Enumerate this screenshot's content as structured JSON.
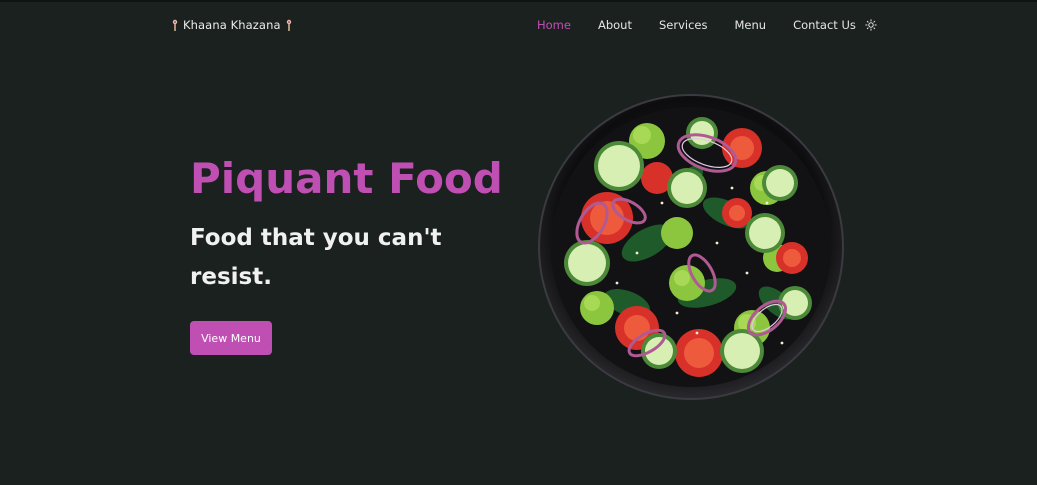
{
  "brand": {
    "name": "Khaana Khazana"
  },
  "nav": {
    "home": "Home",
    "about": "About",
    "services": "Services",
    "menu": "Menu",
    "contact": "Contact Us"
  },
  "hero": {
    "title": "Piquant Food",
    "subtitle": "Food that you can't resist.",
    "cta": "View Menu"
  },
  "colors": {
    "background": "#1b211f",
    "accent": "#c04fb3",
    "text": "#f1f1f1"
  },
  "icons": {
    "brand_left": "fork-spoon-icon",
    "brand_right": "fork-spoon-icon",
    "theme_toggle": "sun-icon",
    "hero_image": "salad-bowl-image"
  }
}
